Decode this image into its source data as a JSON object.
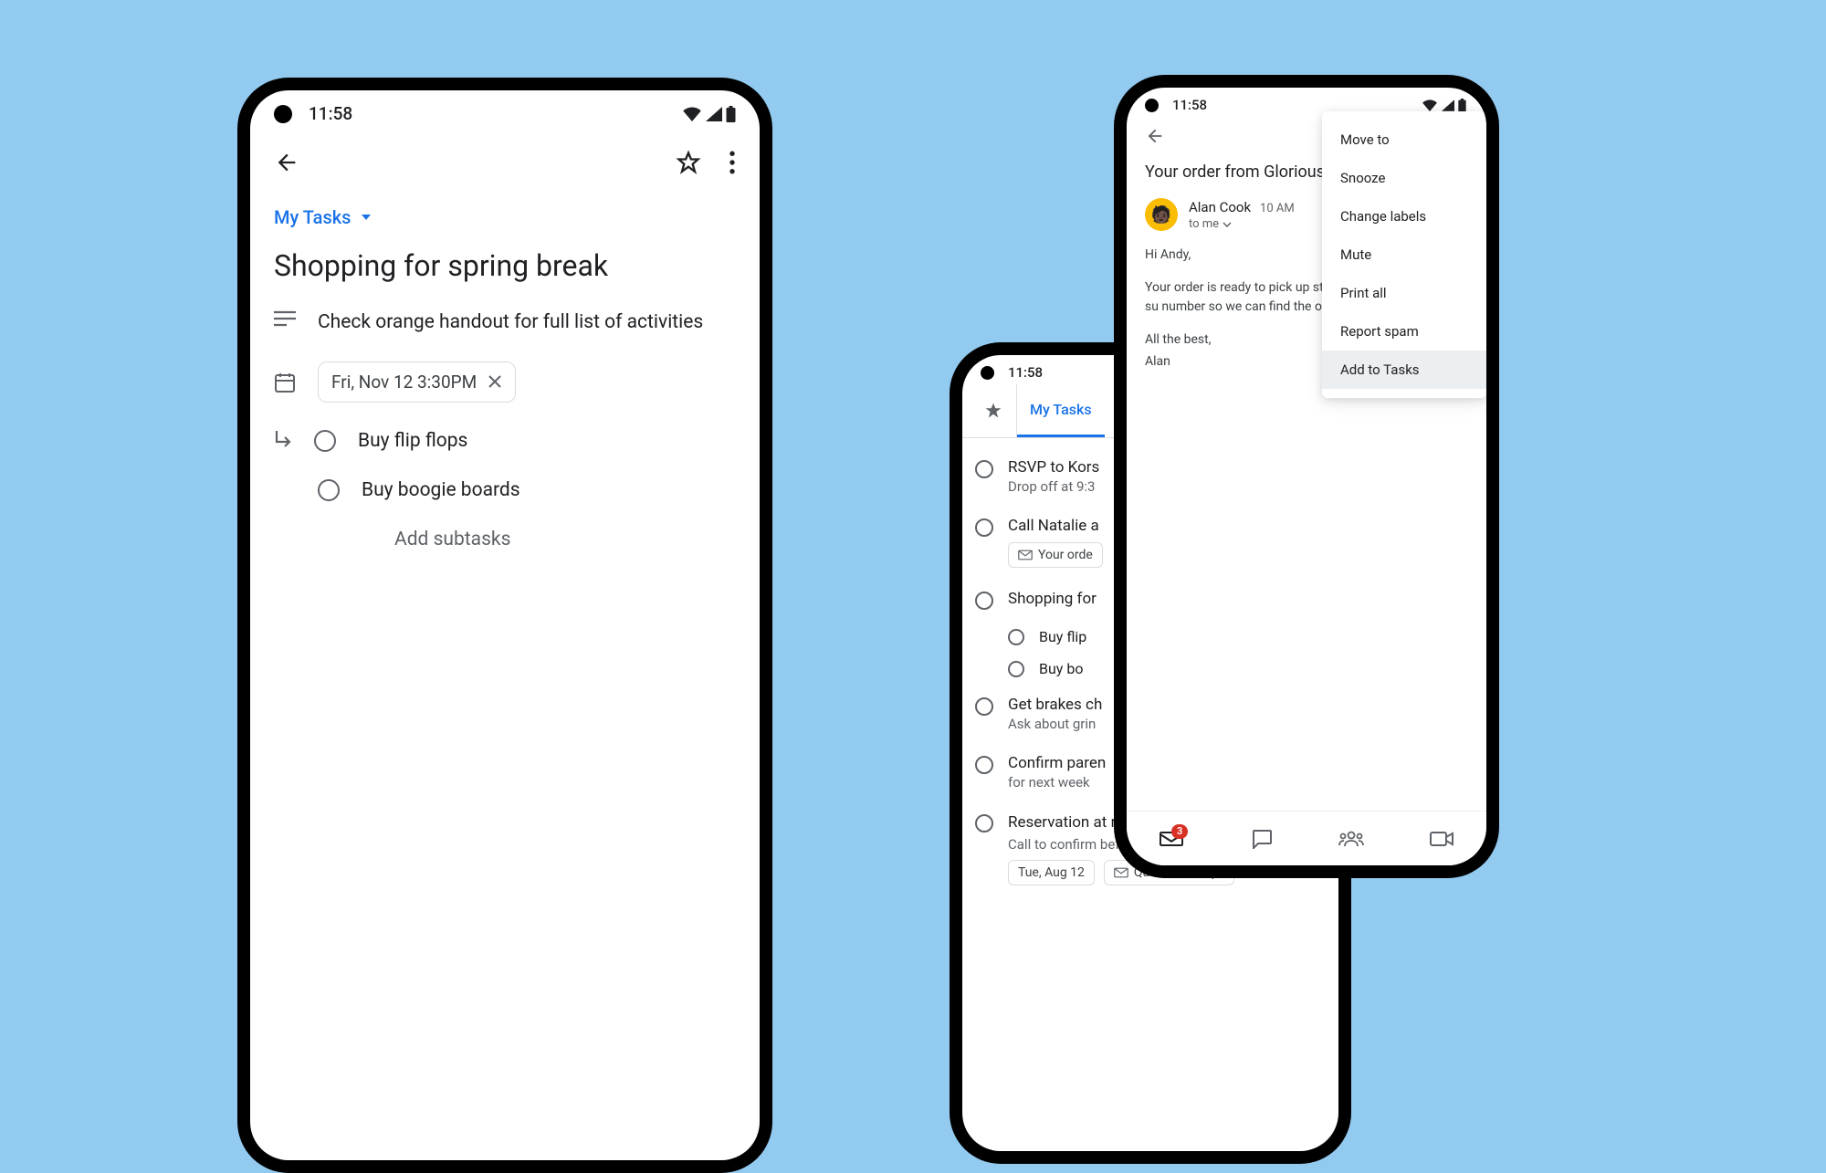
{
  "status_time": "11:58",
  "phone1": {
    "list_label": "My Tasks",
    "title": "Shopping for spring break",
    "description": "Check orange handout for full list of activities",
    "date_chip": "Fri, Nov 12  3:30PM",
    "subtask1": "Buy flip flops",
    "subtask2": "Buy boogie boards",
    "add_subtasks": "Add subtasks"
  },
  "phone2": {
    "tab_label": "My Tasks",
    "items": {
      "i0": {
        "title": "RSVP to Kors",
        "sub": "Drop off at 9:3"
      },
      "i1": {
        "title": "Call Natalie a",
        "chip": "Your orde"
      },
      "i2": {
        "title": "Shopping for"
      },
      "i2a": {
        "title": "Buy flip"
      },
      "i2b": {
        "title": "Buy bo"
      },
      "i3": {
        "title": "Get brakes ch",
        "sub": "Ask about grin"
      },
      "i4": {
        "title": "Confirm paren",
        "sub": "for next week"
      },
      "i5": {
        "title": "Reservation at restaurant with Massimo",
        "sub": "Call to confirm beforehand",
        "chip1": "Tue, Aug 12",
        "chip2": "Quick catch-up?"
      }
    }
  },
  "phone3": {
    "subject": "Your order from Glorious F",
    "sender": "Alan Cook",
    "time": "10 AM",
    "to": "to me",
    "body_greeting": "Hi Andy,",
    "body_main": "Your order is ready to pick up store in Chelsea. Please be su number so we can find the or",
    "body_signoff": "All the best,",
    "body_name": "Alan",
    "menu": {
      "m0": "Move to",
      "m1": "Snooze",
      "m2": "Change labels",
      "m3": "Mute",
      "m4": "Print all",
      "m5": "Report spam",
      "m6": "Add to Tasks"
    },
    "badge": "3"
  }
}
